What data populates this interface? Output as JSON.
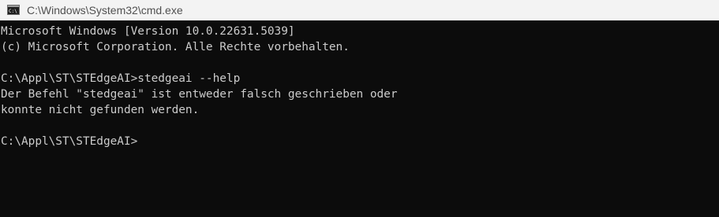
{
  "window": {
    "title": "C:\\Windows\\System32\\cmd.exe",
    "icon": "cmd-icon",
    "colors": {
      "titlebar_bg": "#f3f3f3",
      "console_bg": "#0c0c0c",
      "console_text": "#cccccc"
    }
  },
  "console": {
    "lines": [
      "Microsoft Windows [Version 10.0.22631.5039]",
      "(c) Microsoft Corporation. Alle Rechte vorbehalten.",
      "",
      "C:\\Appl\\ST\\STEdgeAI>stedgeai --help",
      "Der Befehl \"stedgeai\" ist entweder falsch geschrieben oder",
      "konnte nicht gefunden werden.",
      "",
      "C:\\Appl\\ST\\STEdgeAI>"
    ]
  }
}
